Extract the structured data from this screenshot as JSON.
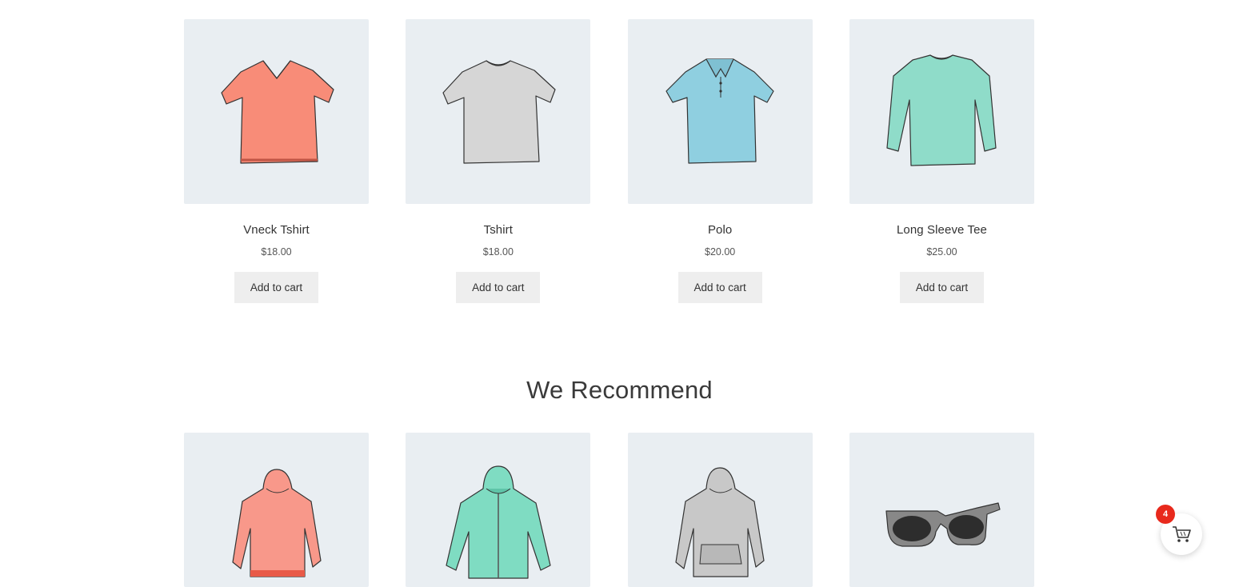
{
  "featured": [
    {
      "name": "Vneck Tshirt",
      "price": "$18.00",
      "button": "Add to cart",
      "icon": "vneck-tshirt-image",
      "color": "#f88c78"
    },
    {
      "name": "Tshirt",
      "price": "$18.00",
      "button": "Add to cart",
      "icon": "tshirt-image",
      "color": "#d4d4d4"
    },
    {
      "name": "Polo",
      "price": "$20.00",
      "button": "Add to cart",
      "icon": "polo-image",
      "color": "#8fcfe0"
    },
    {
      "name": "Long Sleeve Tee",
      "price": "$25.00",
      "button": "Add to cart",
      "icon": "long-sleeve-tee-image",
      "color": "#8fdcc9"
    }
  ],
  "recommend": {
    "heading": "We Recommend",
    "items": [
      {
        "icon": "hoodie-pink-image",
        "color": "#f8988a"
      },
      {
        "icon": "zip-hoodie-image",
        "color": "#7fdcc2"
      },
      {
        "icon": "hoodie-grey-image",
        "color": "#c8c8c8"
      },
      {
        "icon": "sunglasses-image",
        "color": "#888888"
      }
    ]
  },
  "cart": {
    "count": "4",
    "icon": "cart-icon",
    "badge_color": "#e8291c"
  }
}
